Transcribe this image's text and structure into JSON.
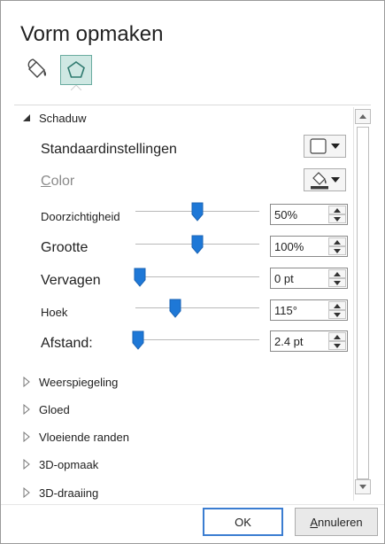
{
  "dialog": {
    "title": "Vorm opmaken",
    "tabs": [
      {
        "name": "fill-line",
        "icon": "paint-bucket-icon",
        "selected": false
      },
      {
        "name": "effects",
        "icon": "pentagon-icon",
        "selected": true
      }
    ]
  },
  "shadow": {
    "header": "Schaduw",
    "expanded": true,
    "presets_label": "Standaardinstellingen",
    "color_label_initial": "C",
    "color_label_rest": "olor",
    "rows": [
      {
        "label": "Doorzichtigheid",
        "value": "50%",
        "level": 0.5
      },
      {
        "label": "Grootte",
        "value": "100%",
        "level": 0.5
      },
      {
        "label": "Vervagen",
        "value": "0 pt",
        "level": 0.0
      },
      {
        "label": "Hoek",
        "value": "115°",
        "level": 0.32
      },
      {
        "label": "Afstand:",
        "value": "2.4 pt",
        "level": 0.02
      }
    ]
  },
  "sections": [
    {
      "label": "Weerspiegeling"
    },
    {
      "label": "Gloed"
    },
    {
      "label": "Vloeiende randen"
    },
    {
      "label": "3D-opmaak"
    },
    {
      "label": "3D-draaiing"
    }
  ],
  "buttons": {
    "ok": "OK",
    "cancel_initial": "A",
    "cancel_rest": "nnuleren"
  },
  "colors": {
    "accent": "#1e78d7",
    "selected_tab": "#cfe8e3",
    "ok_border": "#3b7dd1"
  }
}
